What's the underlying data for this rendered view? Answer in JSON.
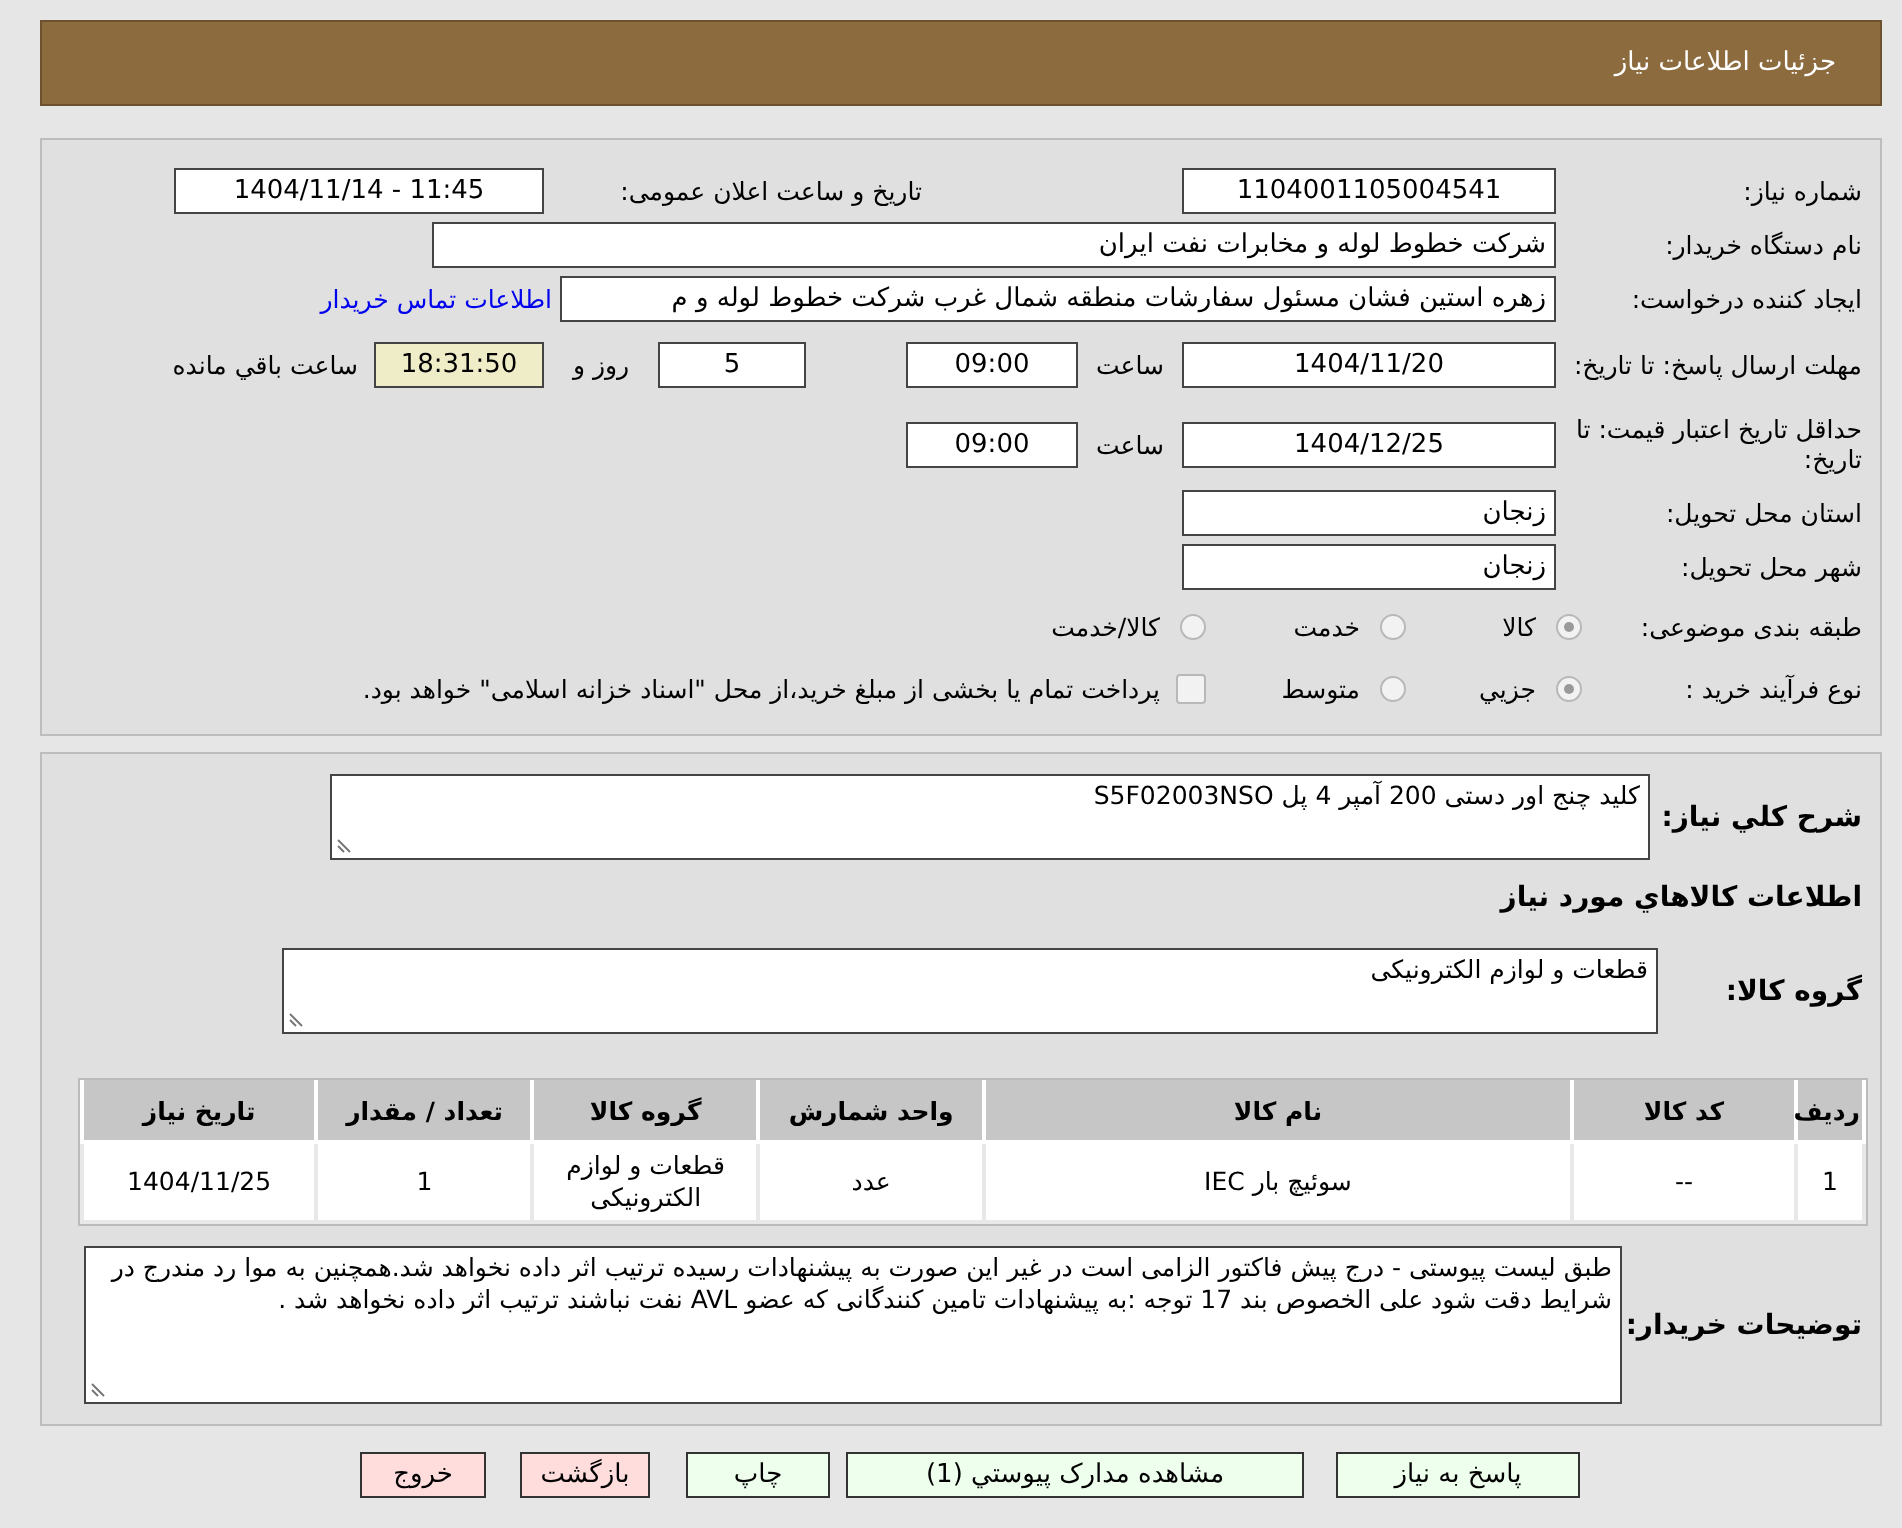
{
  "header": {
    "title": "جزئیات اطلاعات نیاز"
  },
  "need_number": {
    "label": "شماره نیاز:",
    "value": "1104001105004541"
  },
  "announce_datetime": {
    "label": "تاریخ و ساعت اعلان عمومی:",
    "value": "1404/11/14 - 11:45"
  },
  "buyer_org": {
    "label": "نام دستگاه خریدار:",
    "value": "شرکت خطوط لوله و مخابرات نفت ایران"
  },
  "requester": {
    "label": "ایجاد کننده درخواست:",
    "value": "زهره استین فشان مسئول سفارشات منطقه شمال غرب شرکت خطوط لوله و م",
    "link": "اطلاعات تماس خریدار"
  },
  "response_deadline": {
    "label": "مهلت ارسال پاسخ: تا تاریخ:",
    "date": "1404/11/20",
    "time_label": "ساعت",
    "time": "09:00",
    "days": "5",
    "days_label": "روز و",
    "remaining": "18:31:50",
    "remaining_label": "ساعت باقي مانده"
  },
  "price_validity": {
    "label": "حداقل تاریخ اعتبار قیمت: تا تاریخ:",
    "date": "1404/12/25",
    "time_label": "ساعت",
    "time": "09:00"
  },
  "province": {
    "label": "استان محل تحویل:",
    "value": "زنجان"
  },
  "city": {
    "label": "شهر محل تحویل:",
    "value": "زنجان"
  },
  "category": {
    "label": "طبقه بندی موضوعی:",
    "options": [
      {
        "label": "کالا",
        "selected": true
      },
      {
        "label": "خدمت",
        "selected": false
      },
      {
        "label": "کالا/خدمت",
        "selected": false
      }
    ]
  },
  "process": {
    "label": "نوع فرآیند خرید :",
    "options": [
      {
        "label": "جزيي",
        "selected": true
      },
      {
        "label": "متوسط",
        "selected": false
      }
    ],
    "treasury": {
      "checked": false,
      "label": "پرداخت تمام یا بخشی از مبلغ خرید،از محل \"اسناد خزانه اسلامی\" خواهد بود."
    }
  },
  "description": {
    "label": "شرح کلي نیاز:",
    "value": "کلید چنج اور دستی 200 آمپر 4 پل S5F02003NSO"
  },
  "items_heading": "اطلاعات کالاهاي مورد نیاز",
  "goods_group": {
    "label": "گروه کالا:",
    "value": "قطعات و لوازم الکترونیکی"
  },
  "table": {
    "columns": [
      "ردیف",
      "کد کالا",
      "نام کالا",
      "واحد شمارش",
      "گروه کالا",
      "تعداد / مقدار",
      "تاریخ نیاز"
    ],
    "rows": [
      [
        "1",
        "--",
        "سوئیچ بار IEC",
        "عدد",
        "قطعات و لوازم الکترونیکی",
        "1",
        "1404/11/25"
      ]
    ]
  },
  "buyer_notes": {
    "label": "توضیحات خریدار:",
    "value": "طبق لیست پیوستی - درج پیش فاکتور الزامی است در غیر این صورت به پیشنهادات رسیده ترتیب اثر داده نخواهد شد.همچنین به موا رد مندرج در شرایط دقت شود علی الخصوص بند 17 توجه :به پیشنهادات تامین کنندگانی که عضو AVL نفت نباشند ترتیب اثر داده نخواهد شد ."
  },
  "buttons": [
    {
      "label": "پاسخ به نیاز",
      "kind": "action"
    },
    {
      "label": "مشاهده مدارک پیوستي (1)",
      "kind": "action"
    },
    {
      "label": "چاپ",
      "kind": "action"
    },
    {
      "label": "بازگشت",
      "kind": "exit"
    },
    {
      "label": "خروج",
      "kind": "exit"
    }
  ]
}
